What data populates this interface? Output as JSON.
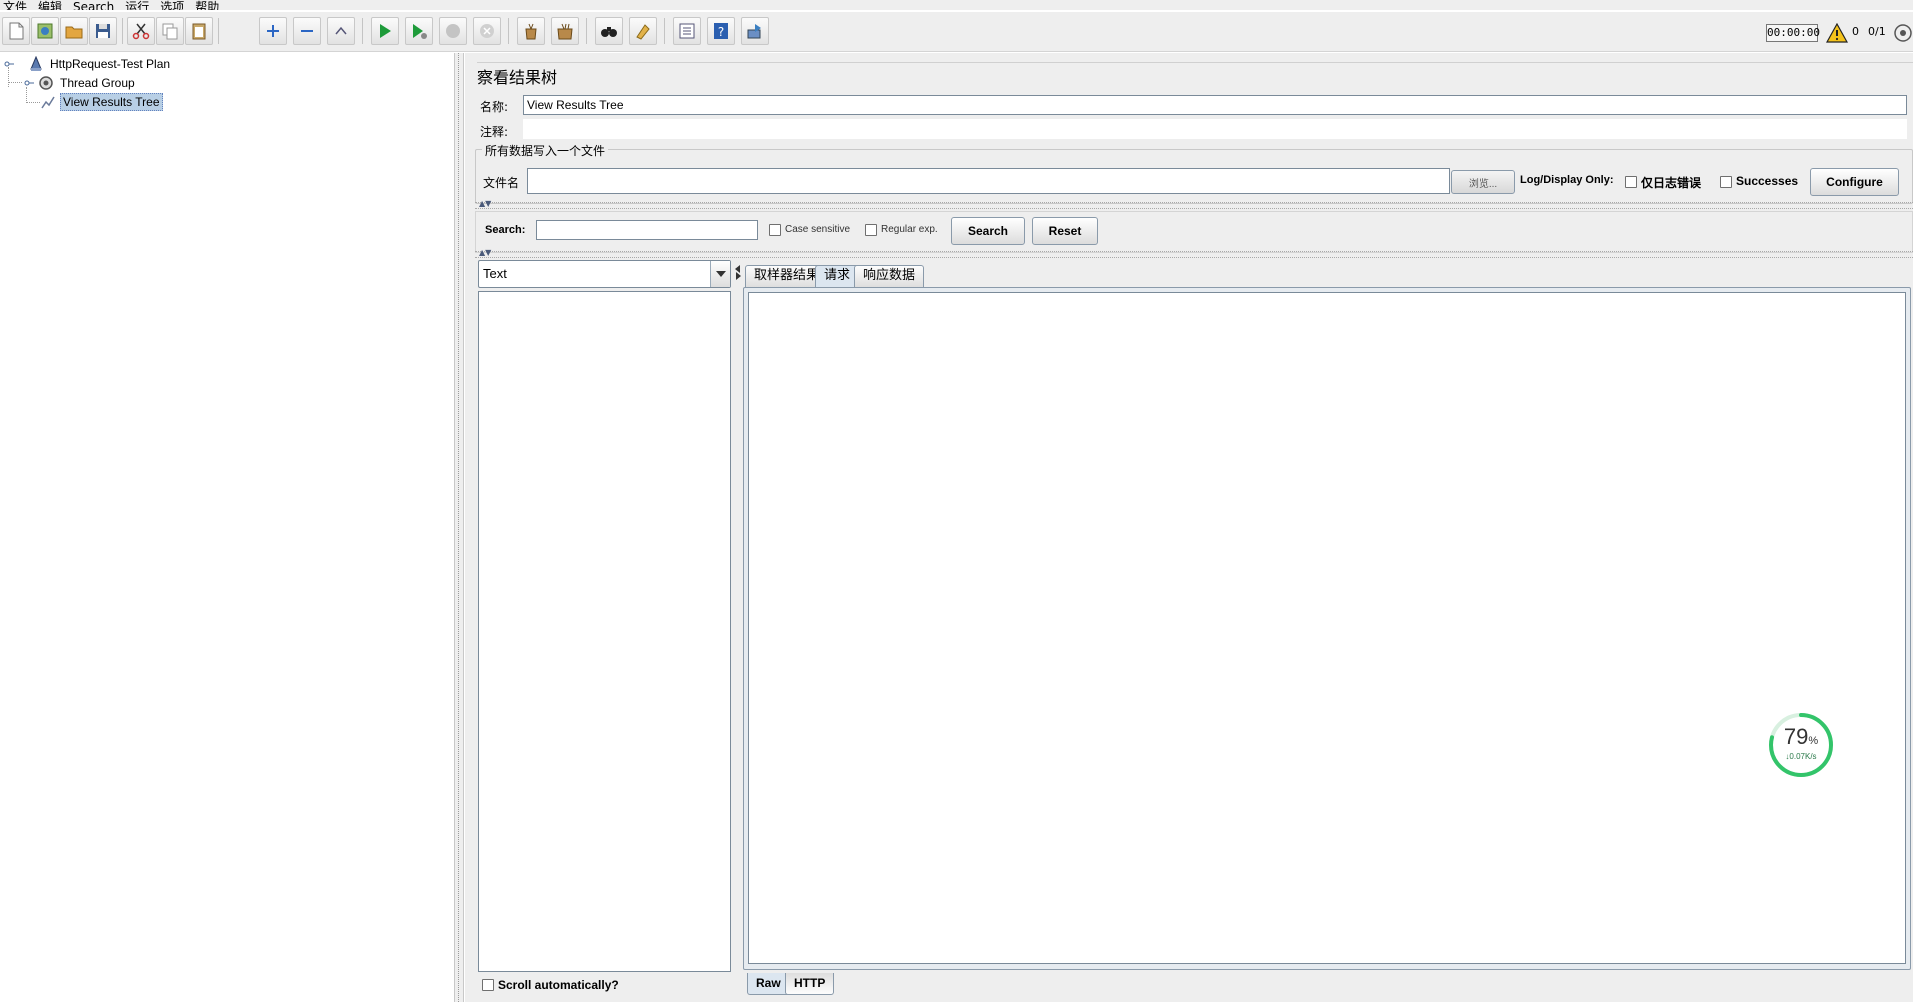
{
  "menu": [
    "文件",
    "编辑",
    "Search",
    "运行",
    "选项",
    "帮助"
  ],
  "toolbar": {
    "buttons": [
      "new-icon",
      "templates-icon",
      "open-icon",
      "save-icon",
      "cut-icon",
      "copy-icon",
      "paste-icon",
      "expand-icon",
      "collapse-icon",
      "toggle-icon",
      "start-icon",
      "start-no-pause-icon",
      "stop-icon",
      "shutdown-icon",
      "clear-icon",
      "clear-all-icon",
      "search-icon",
      "reset-search-icon",
      "function-helper-icon",
      "help-icon",
      "remote-start-icon"
    ],
    "elapsed_time": "00:00:00",
    "warning_count": "0",
    "threads": "0/1"
  },
  "tree": {
    "items": [
      {
        "label": "HttpRequest-Test Plan",
        "icon": "test-plan-icon"
      },
      {
        "label": "Thread Group",
        "icon": "thread-group-icon"
      },
      {
        "label": "View Results Tree",
        "icon": "listener-icon",
        "selected": true
      }
    ]
  },
  "panel": {
    "title": "察看结果树",
    "name_label": "名称:",
    "name_value": "View Results Tree",
    "comment_label": "注释:",
    "comment_value": "",
    "file_group_title": "所有数据写入一个文件",
    "filename_label": "文件名",
    "filename_value": "",
    "browse_label": "浏览...",
    "log_display_label": "Log/Display Only:",
    "errors_only_label": "仅日志错误",
    "successes_label": "Successes",
    "configure_label": "Configure"
  },
  "search": {
    "label": "Search:",
    "value": "",
    "case_sensitive_label": "Case sensitive",
    "regex_label": "Regular exp.",
    "search_button": "Search",
    "reset_button": "Reset"
  },
  "results": {
    "renderer": "Text",
    "scroll_auto_label": "Scroll automatically?",
    "tabs": [
      "取样器结果",
      "请求",
      "响应数据"
    ],
    "active_tab": "请求",
    "bottom_tabs": [
      "Raw",
      "HTTP"
    ],
    "active_bottom_tab": "Raw"
  },
  "net_widget": {
    "percent": "79",
    "percent_unit": "%",
    "speed": "↓0.07K/s"
  },
  "colors": {
    "background": "#eeeeee",
    "selection": "#b8cfe5",
    "net_ring": "#33c46a"
  }
}
